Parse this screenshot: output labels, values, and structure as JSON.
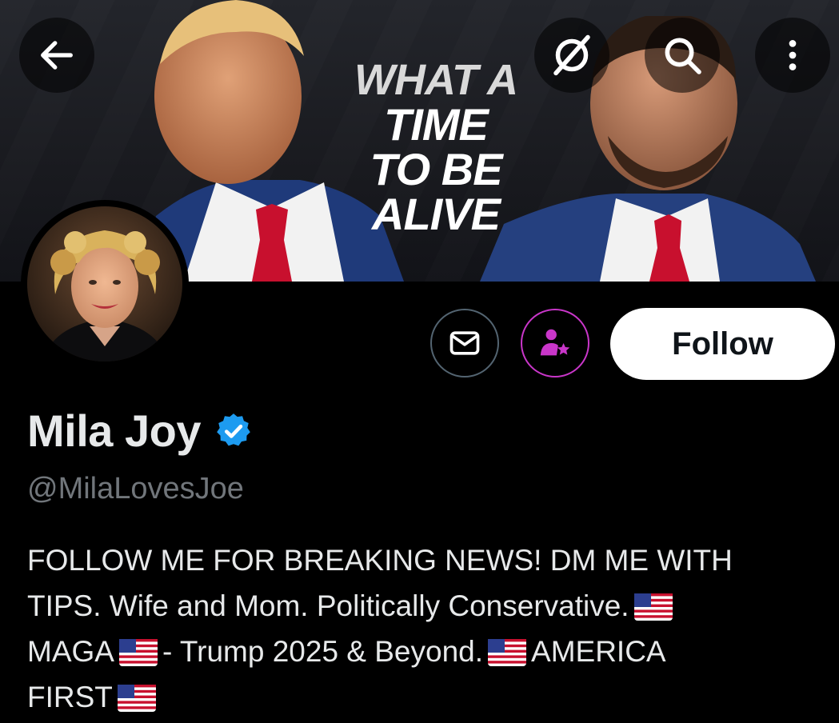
{
  "banner": {
    "slogan": [
      "WHAT A",
      "TIME",
      "TO BE",
      "ALIVE"
    ]
  },
  "controls": {
    "back": "back-arrow-icon",
    "grok": "grok-slash-icon",
    "search": "search-icon",
    "more": "more-vertical-icon"
  },
  "actions": {
    "message_icon": "mail-icon",
    "subscribe_icon": "subscribe-person-star-icon",
    "follow_label": "Follow",
    "subscribe_color": "#c936c9"
  },
  "profile": {
    "name": "Mila Joy",
    "verified_color": "#1d9bf0",
    "handle": "@MilaLovesJoe"
  },
  "bio": {
    "line1": "FOLLOW ME FOR BREAKING NEWS! DM ME WITH",
    "line2": "TIPS. Wife and Mom. Politically Conservative.",
    "line3a": "MAGA",
    "line3b": "- Trump 2025 & Beyond.",
    "line3c": "AMERICA",
    "line4": "FIRST",
    "flag": "us-flag-emoji"
  }
}
